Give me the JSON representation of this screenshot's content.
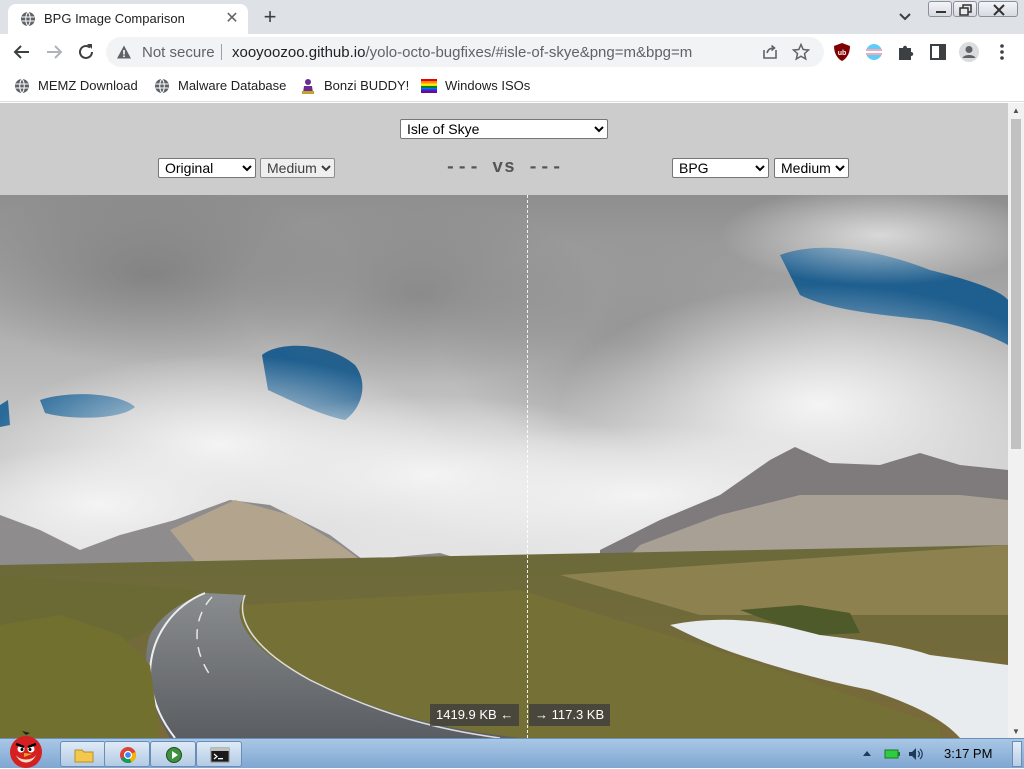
{
  "browser": {
    "tab": {
      "title": "BPG Image Comparison",
      "close": "✕"
    },
    "new_tab": "+",
    "omnibox": {
      "security": "Not secure",
      "url_host": "xooyoozoo.github.io",
      "url_path": "/yolo-octo-bugfixes/#isle-of-skye&png=m&bpg=m"
    },
    "bookmarks": [
      {
        "label": "MEMZ Download",
        "icon": "globe-icon"
      },
      {
        "label": "Malware Database",
        "icon": "globe-icon"
      },
      {
        "label": "Bonzi BUDDY!",
        "icon": "bonzi-icon"
      },
      {
        "label": "Windows ISOs",
        "icon": "windows-flag-icon"
      }
    ]
  },
  "page": {
    "image_select": {
      "selected": "Isle of Skye"
    },
    "left": {
      "format": "Original",
      "quality": "Medium",
      "size_text": "1419.9 KB ←"
    },
    "vs_text": "--- vs ---",
    "right": {
      "format": "BPG",
      "quality": "Medium",
      "size_text": "→ 117.3 KB"
    },
    "split_position": 0.523
  },
  "taskbar": {
    "items": [
      "explorer-icon",
      "chrome-icon",
      "media-player-icon",
      "cmd-icon"
    ],
    "clock": "3:17 PM"
  },
  "colors": {
    "page_bg": "#cccccc",
    "tabstrip_bg": "#dee1e6",
    "omnibox_bg": "#f1f3f4",
    "taskbar_bg": "#93b6dc"
  }
}
